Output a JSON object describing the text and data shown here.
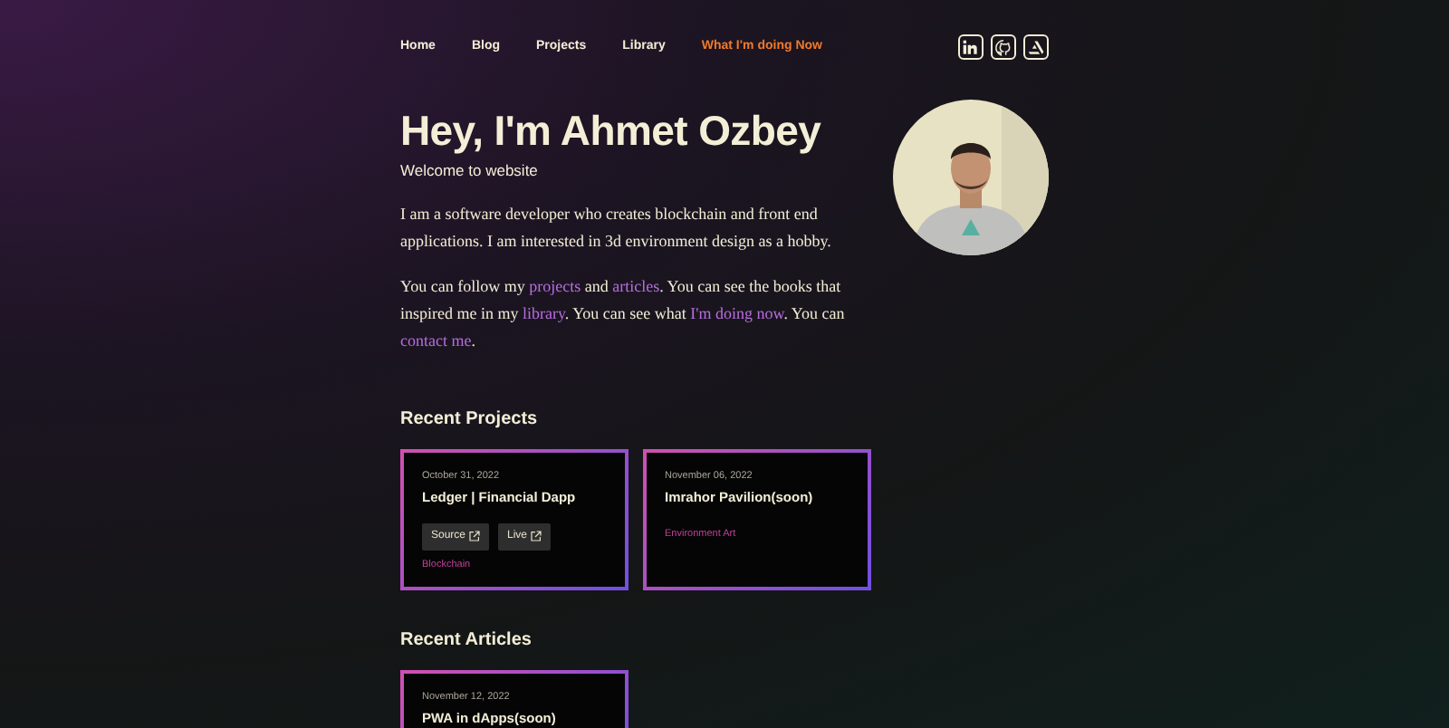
{
  "nav": {
    "items": [
      {
        "label": "Home",
        "selected": false
      },
      {
        "label": "Blog",
        "selected": false
      },
      {
        "label": "Projects",
        "selected": false
      },
      {
        "label": "Library",
        "selected": false
      },
      {
        "label": "What I'm doing Now",
        "selected": true
      }
    ],
    "social": [
      {
        "kind": "linkedin"
      },
      {
        "kind": "github"
      },
      {
        "kind": "artstation"
      }
    ]
  },
  "hero": {
    "title": "Hey, I'm Ahmet Ozbey",
    "subtitle": "Welcome to website",
    "paragraphs": [
      [
        {
          "text": "I am a software developer who creates blockchain and front end applications. I am interested in 3d environment design as a hobby."
        }
      ],
      [
        {
          "text": "You can follow my "
        },
        {
          "text": "projects",
          "kind": "link"
        },
        {
          "text": " and "
        },
        {
          "text": "articles",
          "kind": "link"
        },
        {
          "text": ". You can see the books that inspired me in my "
        },
        {
          "text": "library",
          "kind": "link"
        },
        {
          "text": ". You can see what "
        },
        {
          "text": "I'm doing now",
          "kind": "link"
        },
        {
          "text": ". You can "
        },
        {
          "text": "contact me",
          "kind": "link"
        },
        {
          "text": "."
        }
      ]
    ],
    "photo": {
      "kind": "picture"
    }
  },
  "projects": {
    "heading": "Recent Projects",
    "cards": [
      {
        "date": "October 31, 2022",
        "title": "Ledger | Financial Dapp",
        "buttons": [
          "Source",
          "Live"
        ],
        "tag": "Blockchain"
      },
      {
        "date": "November 06, 2022",
        "title": "Imrahor Pavilion(soon)",
        "tag": "Environment Art"
      }
    ]
  },
  "articles": {
    "heading": "Recent Articles",
    "cards": [
      {
        "date": "November 12, 2022",
        "title": "PWA in dApps(soon)"
      }
    ]
  }
}
